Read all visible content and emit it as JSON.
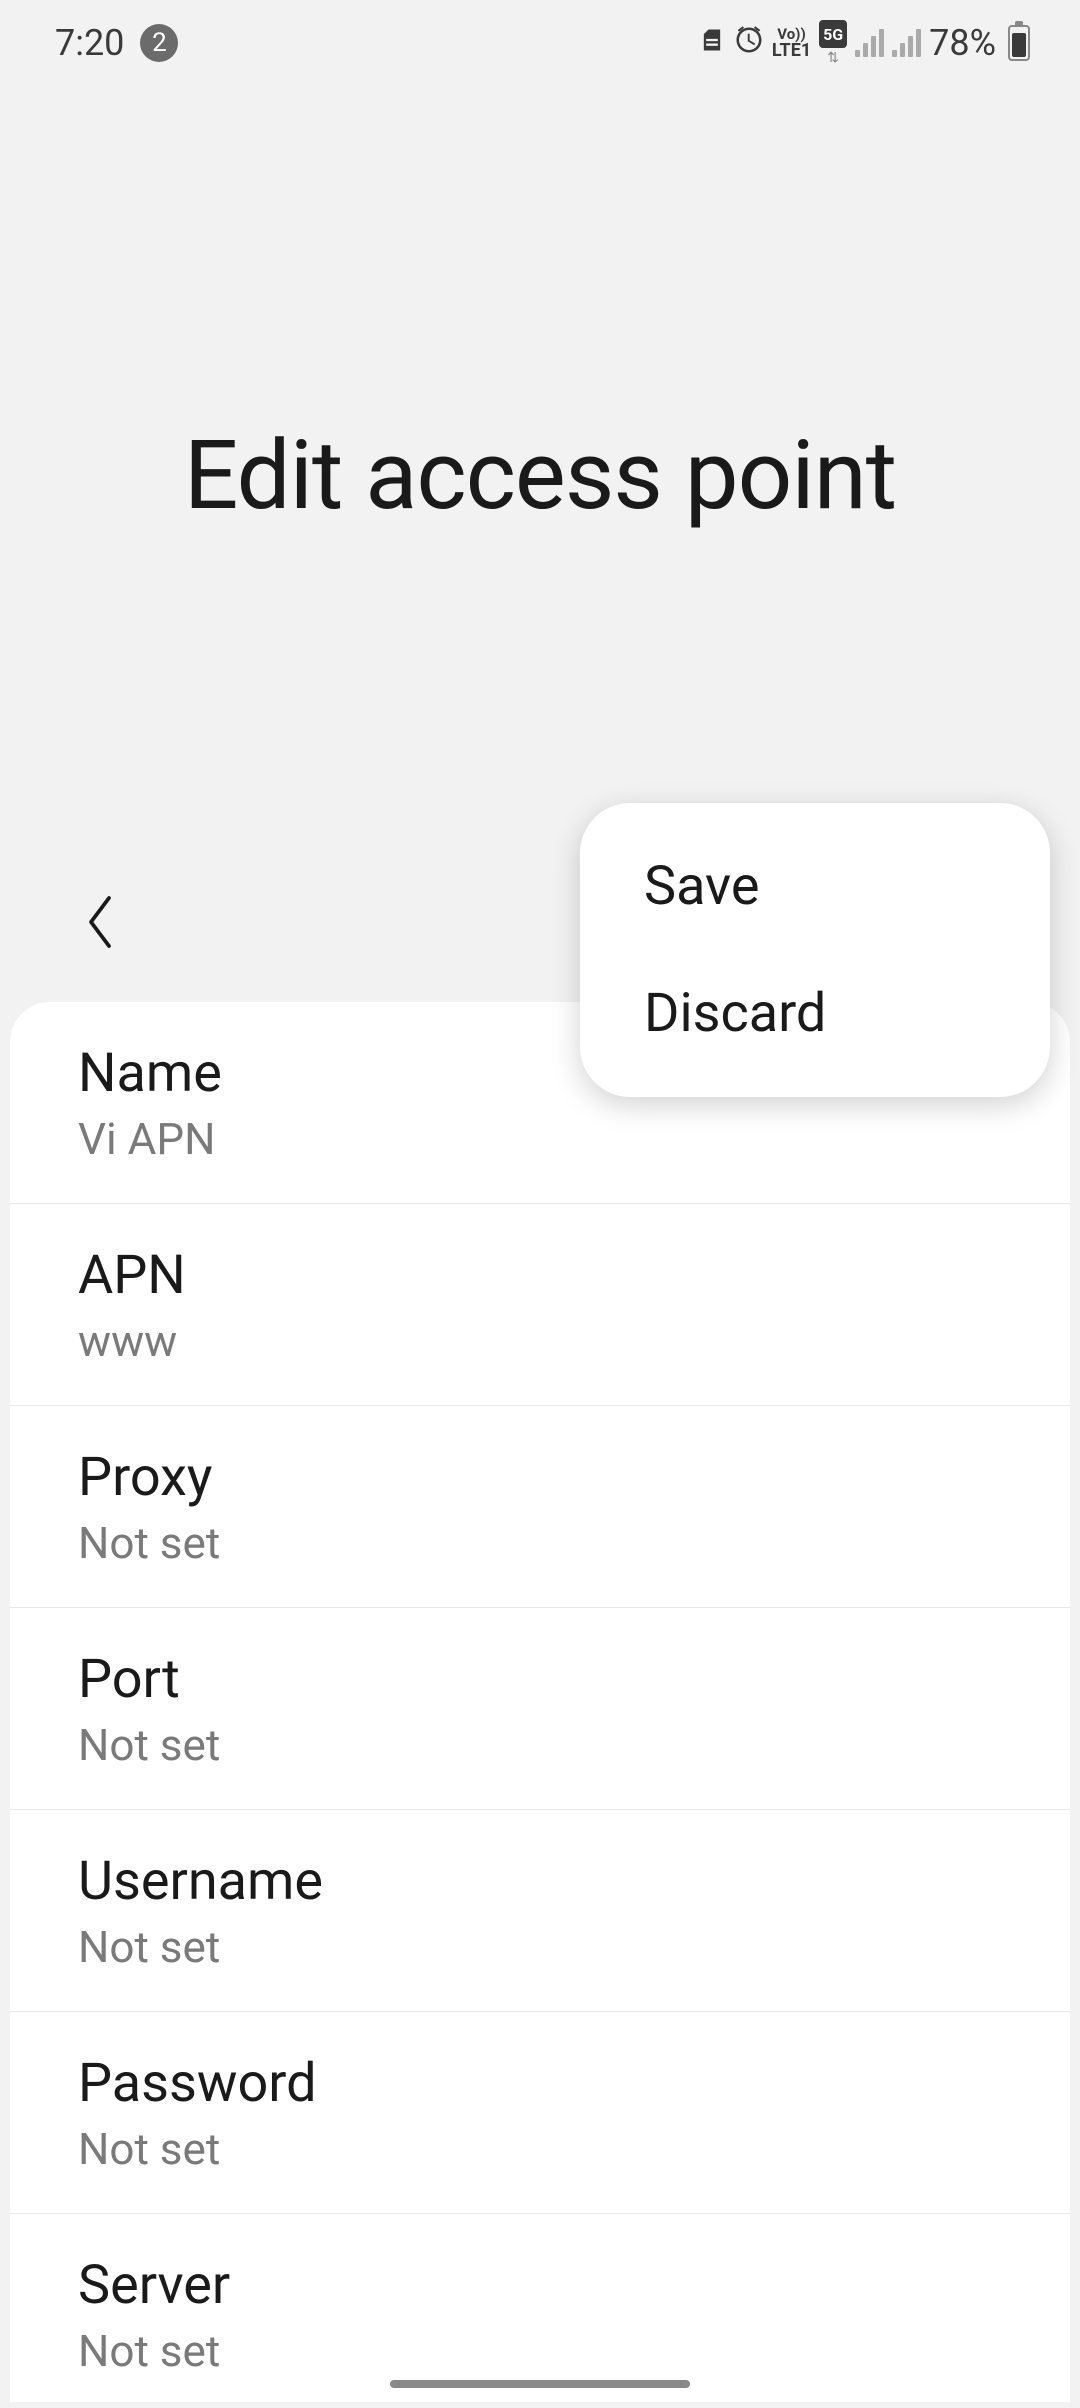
{
  "status_bar": {
    "time": "7:20",
    "notification_count": "2",
    "network_label_1": "Vo))",
    "network_label_2": "LTE1",
    "network_label_3": "5G",
    "battery_percent": "78%"
  },
  "page": {
    "title": "Edit access point"
  },
  "menu": {
    "items": [
      {
        "label": "Save"
      },
      {
        "label": "Discard"
      }
    ]
  },
  "fields": [
    {
      "label": "Name",
      "value": "Vi APN"
    },
    {
      "label": "APN",
      "value": "www"
    },
    {
      "label": "Proxy",
      "value": "Not set"
    },
    {
      "label": "Port",
      "value": "Not set"
    },
    {
      "label": "Username",
      "value": "Not set"
    },
    {
      "label": "Password",
      "value": "Not set"
    },
    {
      "label": "Server",
      "value": "Not set"
    }
  ]
}
